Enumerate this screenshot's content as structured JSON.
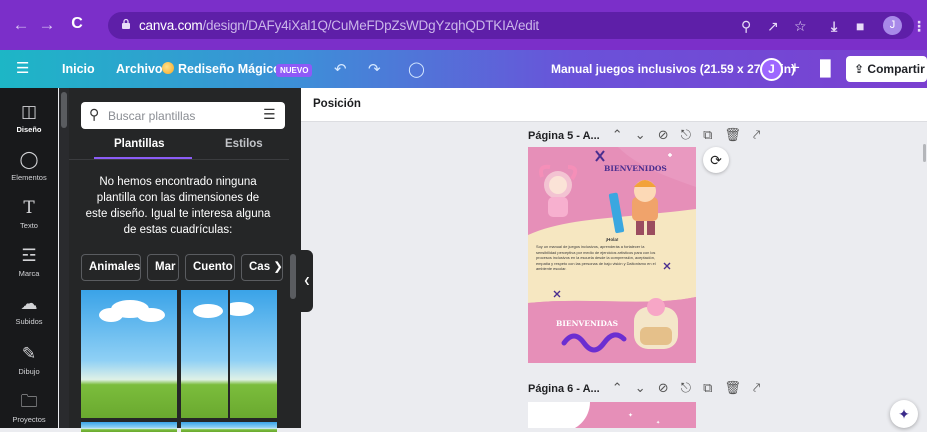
{
  "browser": {
    "url_host": "canva.com",
    "url_path": "/design/DAFy4iXal1Q/CuMeFDpZsWDgYzqhQDTKIA/edit",
    "profile_initial": "J"
  },
  "header": {
    "menu_home": "Inicio",
    "menu_file": "Archivo",
    "magic_redesign": "Rediseño Mágico",
    "new_badge": "NUEVO",
    "doc_title": "Manual juegos inclusivos (21.59 x 27.94 in)",
    "avatar_initial": "J",
    "share_label": "Compartir"
  },
  "rail": {
    "items": [
      {
        "label": "Diseño",
        "icon": "layout-icon"
      },
      {
        "label": "Elementos",
        "icon": "elements-icon"
      },
      {
        "label": "Texto",
        "icon": "text-icon"
      },
      {
        "label": "Marca",
        "icon": "brand-icon"
      },
      {
        "label": "Subidos",
        "icon": "upload-icon"
      },
      {
        "label": "Dibujo",
        "icon": "draw-icon"
      },
      {
        "label": "Proyectos",
        "icon": "folder-icon"
      }
    ]
  },
  "panel": {
    "search_placeholder": "Buscar plantillas",
    "tab_templates": "Plantillas",
    "tab_styles": "Estilos",
    "message": "No hemos encontrado ninguna plantilla con las dimensiones de este diseño. Igual te interesa alguna de estas cuadrículas:",
    "chips": [
      "Animales",
      "Mar",
      "Cuento",
      "Cas"
    ]
  },
  "toolbar": {
    "position_label": "Posición"
  },
  "pages": [
    {
      "label": "Página 5 - A..."
    },
    {
      "label": "Página 6 - A..."
    }
  ],
  "page5": {
    "heading_top": "BIENVENIDOS",
    "greeting": "¡Hola!",
    "body": "Soy un manual de juegos inclusivos, aprenderás a fortalecer la sensibilidad perceptiva por medio de ejercicios artísticos para con los procesos inclusivos en la escuela desde la comprensión, aceptación, empatía y respeto con las personas de bajo visión y Daltonismo en el ambiente escolar.",
    "heading_bottom": "BIENVENIDAS"
  },
  "colors": {
    "browser_bg": "#7b2fc9",
    "accent": "#8b5cf6",
    "page_pink": "#e68fb8",
    "page_cream": "#f6e7c1"
  }
}
